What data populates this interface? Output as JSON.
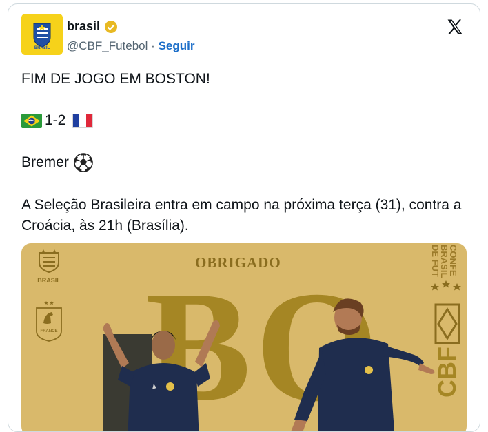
{
  "author": {
    "name": "brasil",
    "handle": "@CBF_Futebol",
    "separator": "·",
    "follow_label": "Seguir",
    "verified_color": "#e8b923",
    "avatar_text": "BRASIL"
  },
  "platform_icon": "x-logo-icon",
  "tweet": {
    "line1": "FIM DE JOGO EM BOSTON!",
    "score": "1-2",
    "scorer": "Bremer",
    "line4": "A Seleção Brasileira entra em campo na próxima terça (31), contra a Croácia, às 21h (Brasília)."
  },
  "media": {
    "heading": "OBRIGADO",
    "big_letters": "BO",
    "brasil_crest_label": "BRASIL",
    "france_crest_label": "FRANCE",
    "side_text": "CONFE BRASIL DE FUT",
    "cbf_text": "CBF"
  },
  "colors": {
    "follow": "#1d6fc9",
    "gold_background": "#d9b96b",
    "gold_dark": "#a58624"
  }
}
